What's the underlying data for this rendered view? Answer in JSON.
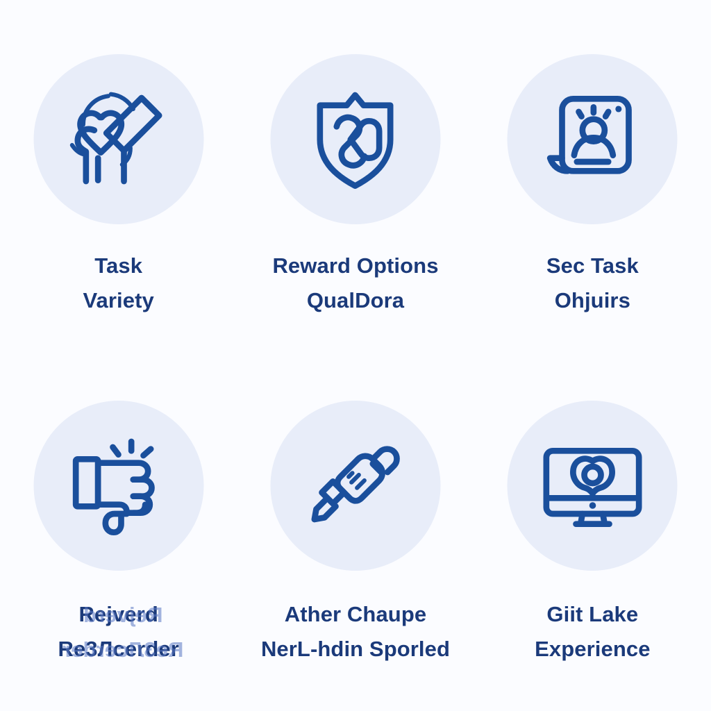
{
  "theme": {
    "page_background": "#fbfcff",
    "medallion_background": "#e8edf9",
    "icon_stroke": "#1a4f9c",
    "label_color": "#1b3a7a"
  },
  "cards": [
    {
      "icon": "raised-arm-with-heart-icon",
      "line1": "Task",
      "line2": "Variety"
    },
    {
      "icon": "shield-icon",
      "line1": "Reward Options",
      "line2": "QualDora"
    },
    {
      "icon": "screen-with-person-icon",
      "line1": "Sec Task",
      "line2": "Ohjuirs"
    },
    {
      "icon": "thumbs-down-icon",
      "line1": "Rejverd",
      "line2": "Re3Лcerder",
      "garbled": true
    },
    {
      "icon": "syringe-icon",
      "line1": "Ather Chaupe",
      "line2": "NerL-hdin Sporled"
    },
    {
      "icon": "desktop-monitor-icon",
      "line1": "Giit Lake",
      "line2": "Experience"
    }
  ]
}
